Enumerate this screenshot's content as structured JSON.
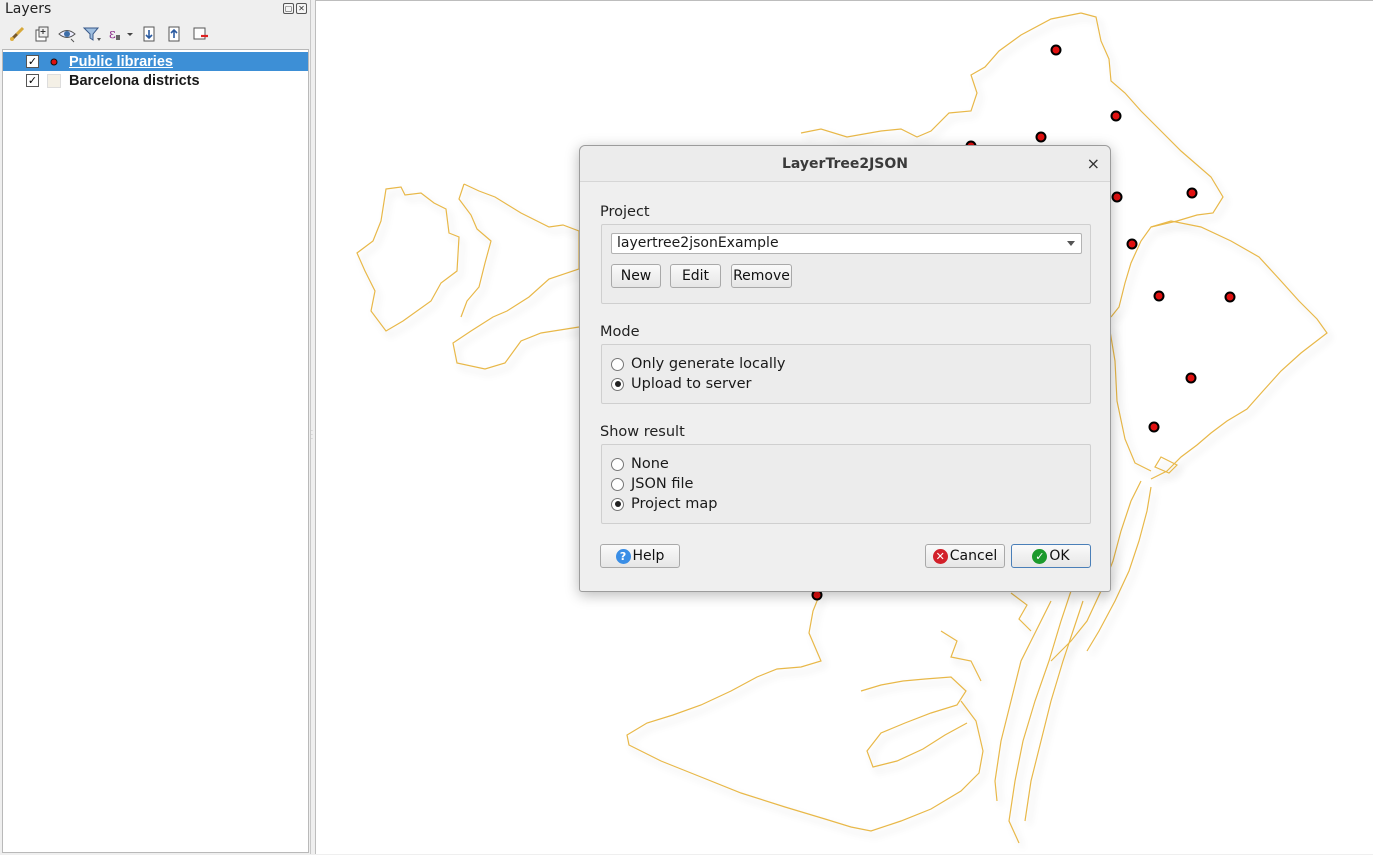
{
  "layers_panel": {
    "title": "Layers",
    "toolbar_icons": [
      "style-brush-icon",
      "add-group-icon",
      "visibility-eye-icon",
      "filter-icon",
      "expression-filter-icon",
      "expand-all-icon",
      "collapse-all-icon",
      "remove-layer-icon"
    ],
    "layers": [
      {
        "name": "Public libraries",
        "checked": true,
        "selected": true,
        "symbol": "red-point"
      },
      {
        "name": "Barcelona districts",
        "checked": true,
        "selected": false,
        "symbol": "polygon-fill"
      }
    ]
  },
  "map": {
    "boundary_color": "#e8b84a",
    "point_color": "#e01010",
    "point_outline": "#000000"
  },
  "dialog": {
    "title": "LayerTree2JSON",
    "close_glyph": "×",
    "project": {
      "label": "Project",
      "selected": "layertree2jsonExample",
      "buttons": {
        "new": "New",
        "edit": "Edit",
        "remove": "Remove"
      }
    },
    "mode": {
      "label": "Mode",
      "options": [
        "Only generate locally",
        "Upload to server"
      ],
      "selected_index": 1
    },
    "show_result": {
      "label": "Show result",
      "options": [
        "None",
        "JSON file",
        "Project map"
      ],
      "selected_index": 2
    },
    "footer": {
      "help": "Help",
      "cancel": "Cancel",
      "ok": "OK",
      "help_color": "#3a8ee6",
      "cancel_color": "#d2202a",
      "ok_color": "#1c9a2c"
    }
  }
}
